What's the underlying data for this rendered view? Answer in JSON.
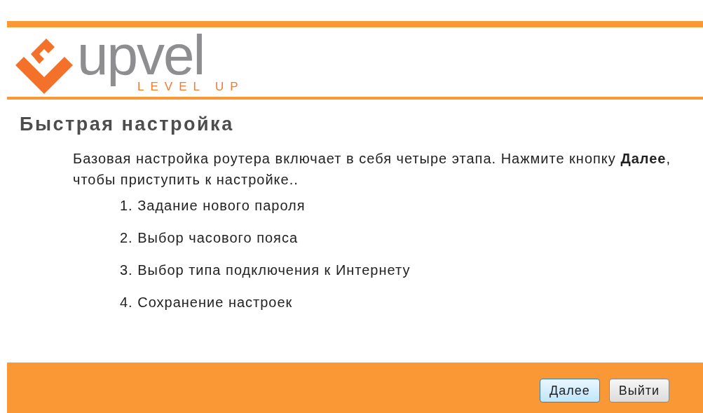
{
  "logo": {
    "name": "upvel",
    "tagline": "LEVEL UP"
  },
  "title": "Быстрая настройка",
  "intro": "Базовая настройка роутера включает в себя четыре этапа. Нажмите кнопку **Далее**, чтобы приступить к настройке..",
  "steps": [
    "1. Задание нового пароля",
    "2. Выбор часового пояса",
    "3. Выбор типа подключения к Интернету",
    "4. Сохранение настроек"
  ],
  "buttons": [
    {
      "label": "Далее",
      "focused": true
    },
    {
      "label": "Выйти",
      "focused": false
    }
  ]
}
